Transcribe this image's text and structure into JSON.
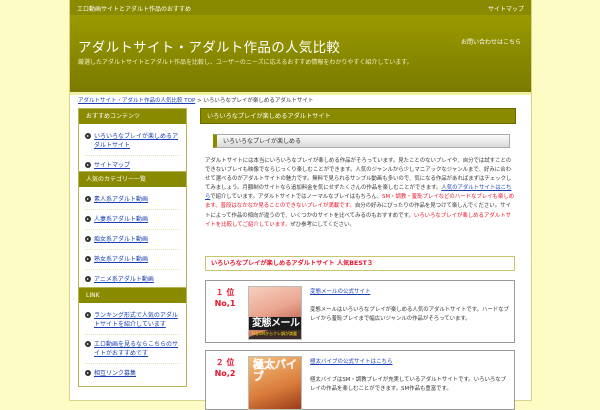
{
  "topbar": {
    "left": "エロ動画サイトとアダルト作品のおすすめ",
    "right": "サイトマップ"
  },
  "header": {
    "title": "アダルトサイト・アダルト作品の人気比較",
    "description": "厳選したアダルトサイトとアダルト作品を比較し、ユーザーのニーズに応えるおすすめ情報をわかりやすく紹介しています。",
    "right_link": "お問い合わせはこちら"
  },
  "breadcrumb": {
    "home": "アダルトサイト・アダルト作品の人気比較 TOP",
    "separator": " > ",
    "current": "いろいろなプレイが楽しめるアダルトサイト"
  },
  "sidebar": {
    "sections": [
      {
        "title": "おすすめコンテンツ",
        "items": [
          "いろいろなプレイが楽しめるアダルトサイト",
          "サイトマップ"
        ]
      },
      {
        "title": "人気のカテゴリー一覧",
        "items": [
          "素人系アダルト動画",
          "人妻系アダルト動画",
          "痴女系アダルト動画",
          "熟女系アダルト動画",
          "アニメ系アダルト動画"
        ]
      },
      {
        "title": "LINK",
        "items": [
          "ランキング形式で人気のアダルトサイトを紹介しています",
          "エロ動画を見るならこちらのサイトがおすすめです",
          "相互リンク募集"
        ]
      }
    ]
  },
  "main": {
    "heading": "いろいろなプレイが楽しめるアダルトサイト",
    "subheading": "いろいろなプレイが楽しめる",
    "paragraph": {
      "p1": "アダルトサイトには本当にいろいろなプレイが楽しめる作品がそろっています。見たことのないプレイや、自分では試すことのできないプレイも映像でならじっくり楽しむことができます。人気のジャンルから少しマニアックなジャンルまで、好みに合わせて選べるのがアダルトサイトの魅力です。無料で見られるサンプル動画も多いので、気になる作品があればまずはチェックしてみましょう。月額制のサイトなら追加料金を気にせずたくさんの作品を楽しむことができます。",
      "link": "人気のアダルトサイトはこちら",
      "p2": "で紹介しています。アダルトサイトではノーマルなプレイはもちろん、",
      "red1": "SM・調教・羞恥プレイなどのハードなプレイも楽しめます。普段はなかなか見ることのできないプレイが満載です。",
      "p3": "自分の好みにぴったりの作品を見つけて楽しんでください。サイトによって作品の傾向が違うので、いくつかのサイトを比べてみるのもおすすめです。",
      "red2": "いろいろなプレイが楽しめるアダルトサイトを比較してご紹介しています。",
      "p4": "ぜひ参考にしてください。"
    },
    "ranking_title": "いろいろなプレイが楽しめるアダルトサイト 人気BEST３",
    "cards": [
      {
        "rank_mark": "１ 位",
        "rank": "No,1",
        "title": "変態メールの公式サイト",
        "text": "変態メールはいろいろなプレイが楽しめる人気のアダルトサイトです。ハードなプレイから羞恥プレイまで幅広いジャンルの作品がそろっています。",
        "thumb_word": "変態メール",
        "thumb_sub": "HなSMからクレ調が満載"
      },
      {
        "rank_mark": "２ 位",
        "rank": "No,2",
        "title": "極太バイブの公式サイトはこちら",
        "text": "極太バイブはSM・調教プレイが充実しているアダルトサイトです。いろいろなプレイの作品を楽しむことができます。SM作品も豊富です。",
        "thumb_word": "極太バイブ"
      }
    ]
  }
}
